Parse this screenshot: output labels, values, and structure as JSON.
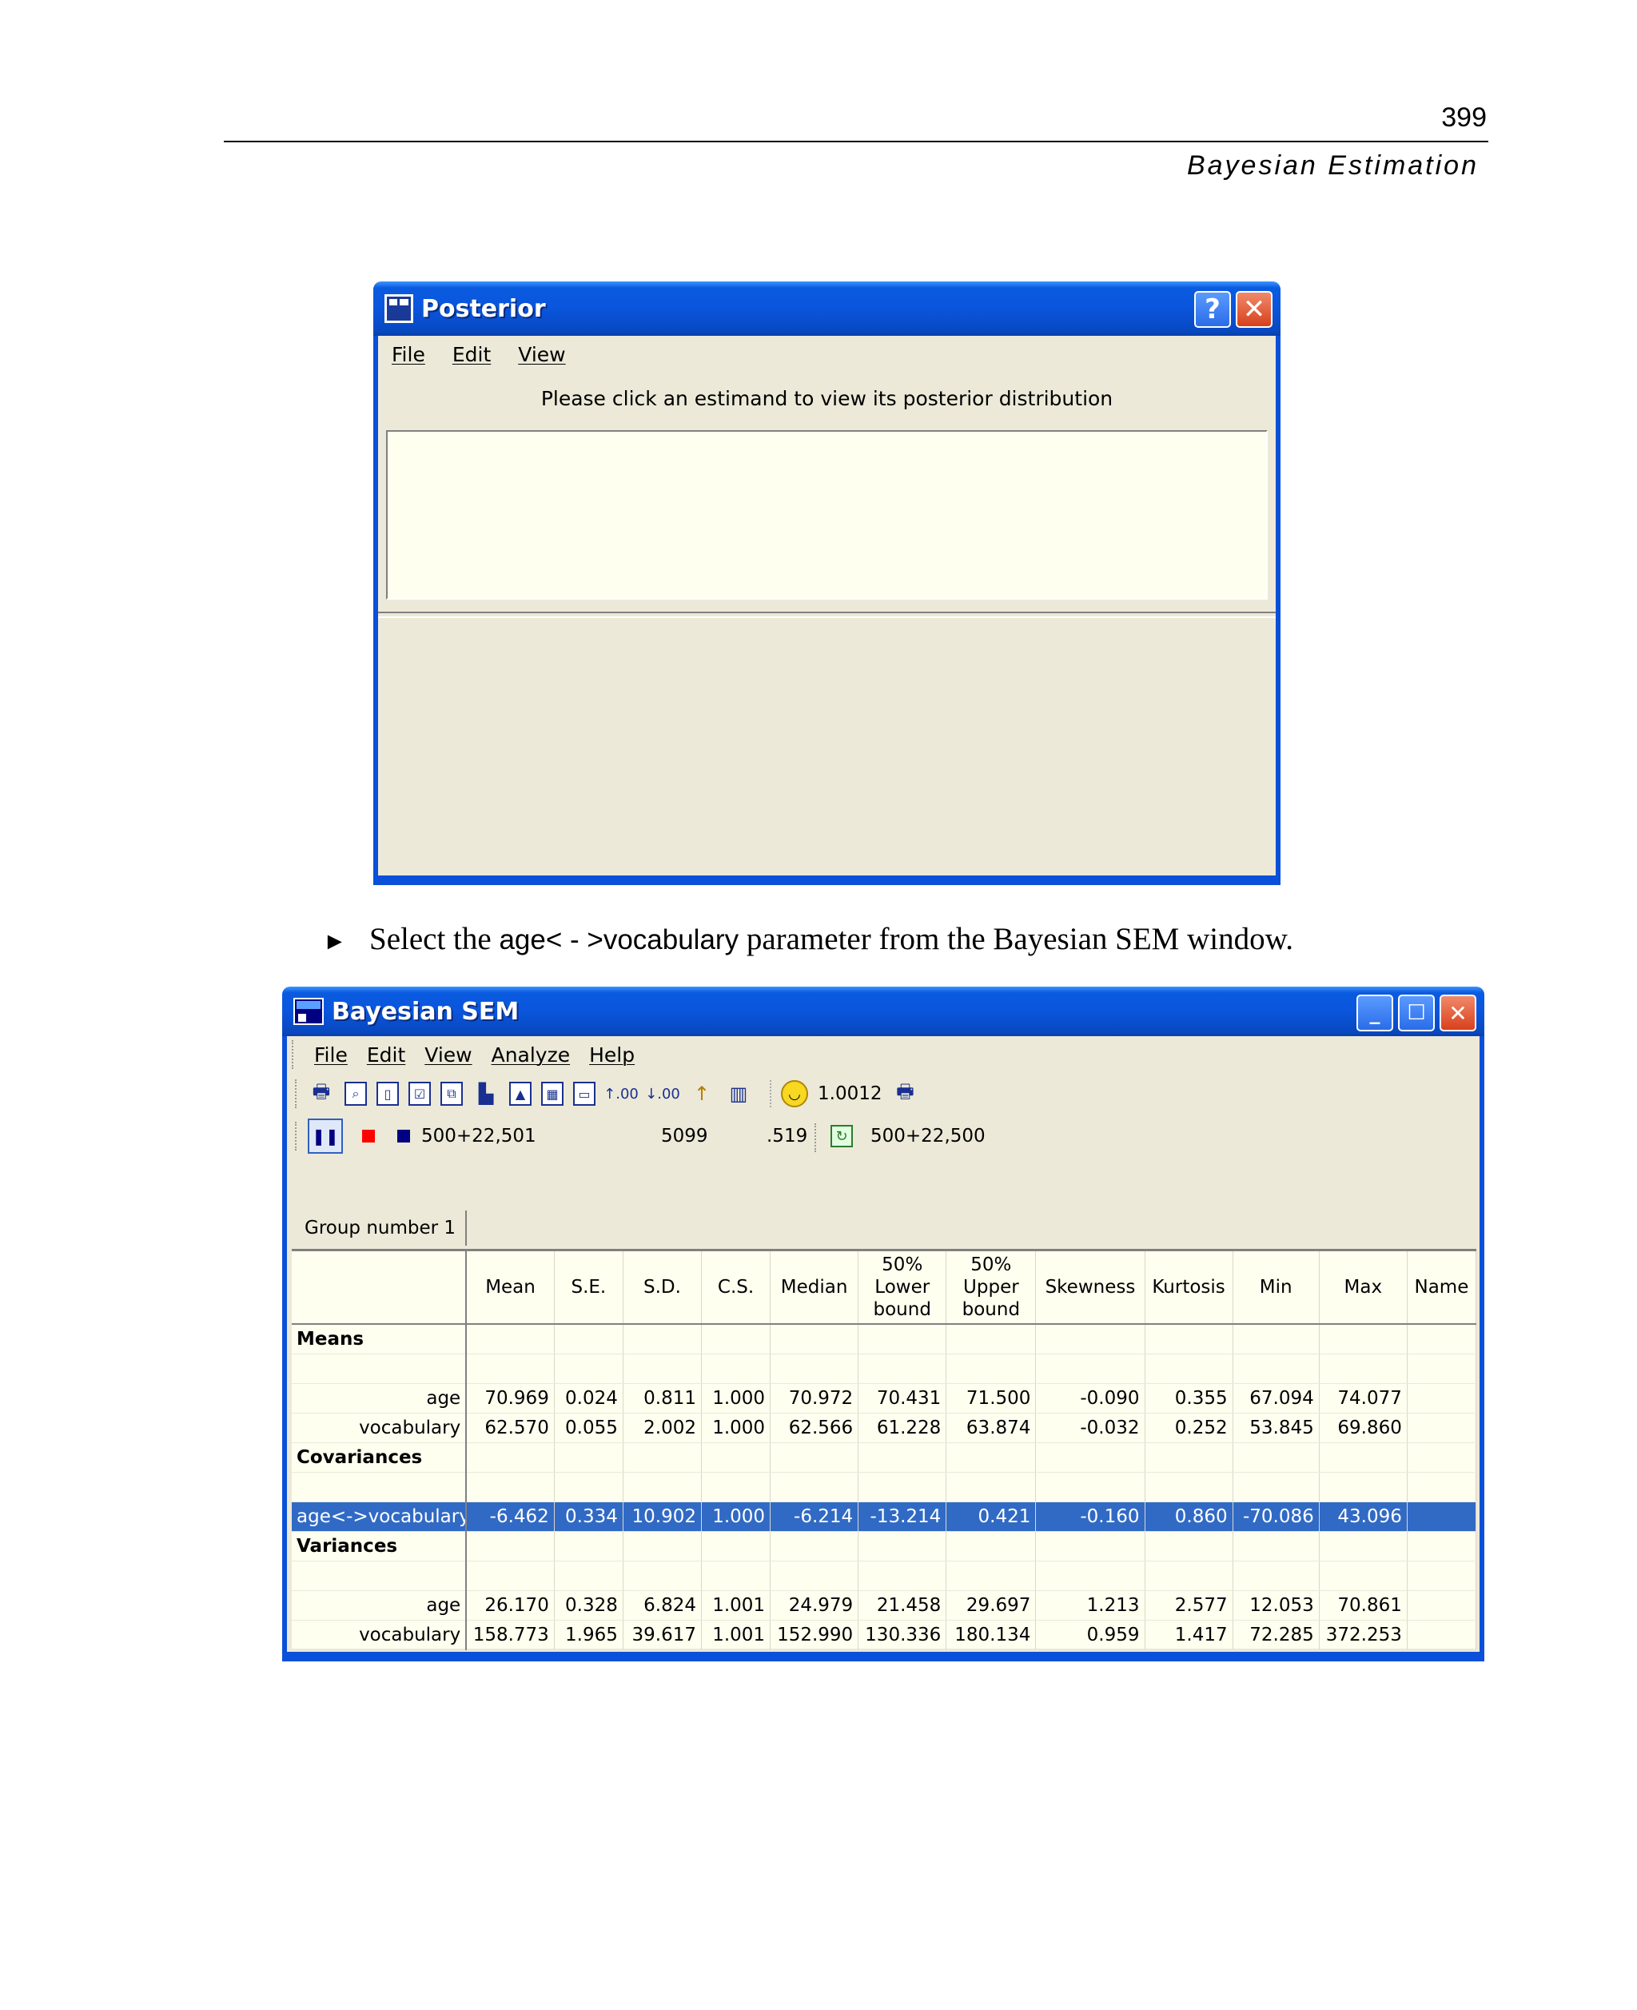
{
  "page": {
    "number": "399",
    "running_head": "Bayesian Estimation",
    "instruction_bullet": "►",
    "instruction_before": "Select the ",
    "instruction_param": "age< - >vocabulary",
    "instruction_after": " parameter from the Bayesian SEM window."
  },
  "posterior": {
    "title": "Posterior",
    "menu": [
      "File",
      "Edit",
      "View"
    ],
    "message": "Please click an estimand to view its posterior distribution",
    "help_btn": "?",
    "close_btn": "✕"
  },
  "sem": {
    "title": "Bayesian SEM",
    "menu": [
      "File",
      "Edit",
      "View",
      "Analyze",
      "Help"
    ],
    "toolbar_value": "1.0012",
    "run_samples": "500+22,501",
    "run_count": "5099",
    "run_rate": ".519",
    "run_samples2": "500+22,500",
    "group_tab": "Group number 1",
    "columns": [
      "Mean",
      "S.E.",
      "S.D.",
      "C.S.",
      "Median",
      "50%\nLower\nbound",
      "50%\nUpper\nbound",
      "Skewness",
      "Kurtosis",
      "Min",
      "Max",
      "Name"
    ],
    "sections": [
      {
        "label": "Means",
        "rows": [
          {
            "label": "age",
            "values": [
              "70.969",
              "0.024",
              "0.811",
              "1.000",
              "70.972",
              "70.431",
              "71.500",
              "-0.090",
              "0.355",
              "67.094",
              "74.077",
              ""
            ]
          },
          {
            "label": "vocabulary",
            "values": [
              "62.570",
              "0.055",
              "2.002",
              "1.000",
              "62.566",
              "61.228",
              "63.874",
              "-0.032",
              "0.252",
              "53.845",
              "69.860",
              ""
            ]
          }
        ]
      },
      {
        "label": "Covariances",
        "rows": [
          {
            "label": "age<->vocabulary",
            "selected": true,
            "values": [
              "-6.462",
              "0.334",
              "10.902",
              "1.000",
              "-6.214",
              "-13.214",
              "0.421",
              "-0.160",
              "0.860",
              "-70.086",
              "43.096",
              ""
            ]
          }
        ]
      },
      {
        "label": "Variances",
        "rows": [
          {
            "label": "age",
            "values": [
              "26.170",
              "0.328",
              "6.824",
              "1.001",
              "24.979",
              "21.458",
              "29.697",
              "1.213",
              "2.577",
              "12.053",
              "70.861",
              ""
            ]
          },
          {
            "label": "vocabulary",
            "values": [
              "158.773",
              "1.965",
              "39.617",
              "1.001",
              "152.990",
              "130.336",
              "180.134",
              "0.959",
              "1.417",
              "72.285",
              "372.253",
              ""
            ]
          }
        ]
      }
    ]
  }
}
